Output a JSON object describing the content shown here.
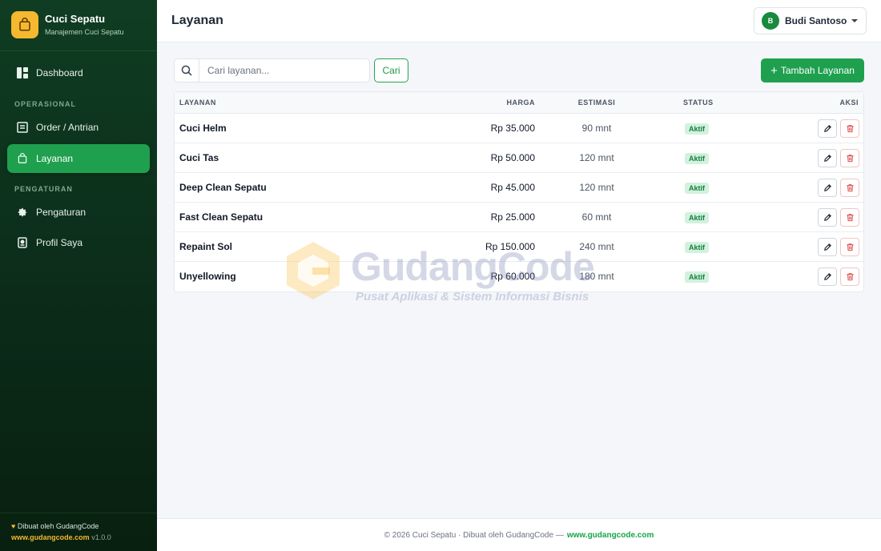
{
  "sidebar": {
    "brand_title": "Cuci Sepatu",
    "brand_subtitle": "Manajemen Cuci Sepatu",
    "items": [
      {
        "label": "Dashboard",
        "icon": "dashboard-icon"
      },
      {
        "label": "Order / Antrian",
        "icon": "receipt-icon"
      },
      {
        "label": "Layanan",
        "icon": "bag-icon",
        "active": true
      },
      {
        "label": "Pengaturan",
        "icon": "gear-icon"
      },
      {
        "label": "Profil Saya",
        "icon": "id-badge-icon"
      }
    ],
    "section_operasional": "OPERASIONAL",
    "section_pengaturan": "PENGATURAN",
    "footer_credit": "Dibuat oleh GudangCode",
    "footer_url": "www.gudangcode.com",
    "footer_version": "v1.0.0"
  },
  "header": {
    "title": "Layanan",
    "user_initial": "B",
    "user_name": "Budi Santoso"
  },
  "toolbar": {
    "search_placeholder": "Cari layanan...",
    "search_button": "Cari",
    "add_button": "Tambah Layanan"
  },
  "table": {
    "columns": {
      "name": "LAYANAN",
      "price": "HARGA",
      "estimate": "ESTIMASI",
      "status": "STATUS",
      "actions": "AKSI"
    },
    "rows": [
      {
        "name": "Cuci Helm",
        "price": "Rp 35.000",
        "estimate": "90 mnt",
        "status": "Aktif"
      },
      {
        "name": "Cuci Tas",
        "price": "Rp 50.000",
        "estimate": "120 mnt",
        "status": "Aktif"
      },
      {
        "name": "Deep Clean Sepatu",
        "price": "Rp 45.000",
        "estimate": "120 mnt",
        "status": "Aktif"
      },
      {
        "name": "Fast Clean Sepatu",
        "price": "Rp 25.000",
        "estimate": "60 mnt",
        "status": "Aktif"
      },
      {
        "name": "Repaint Sol",
        "price": "Rp 150.000",
        "estimate": "240 mnt",
        "status": "Aktif"
      },
      {
        "name": "Unyellowing",
        "price": "Rp 60.000",
        "estimate": "180 mnt",
        "status": "Aktif"
      }
    ]
  },
  "watermark": {
    "title": "GudangCode",
    "subtitle": "Pusat Aplikasi & Sistem Informasi Bisnis"
  },
  "footer": {
    "text": "© 2026 Cuci Sepatu · Dibuat oleh GudangCode —",
    "link": "www.gudangcode.com"
  },
  "colors": {
    "accent": "#1fa04f",
    "brand_yellow": "#f5b82e",
    "sidebar_bg": "#0f3d22",
    "danger": "#e05252"
  }
}
